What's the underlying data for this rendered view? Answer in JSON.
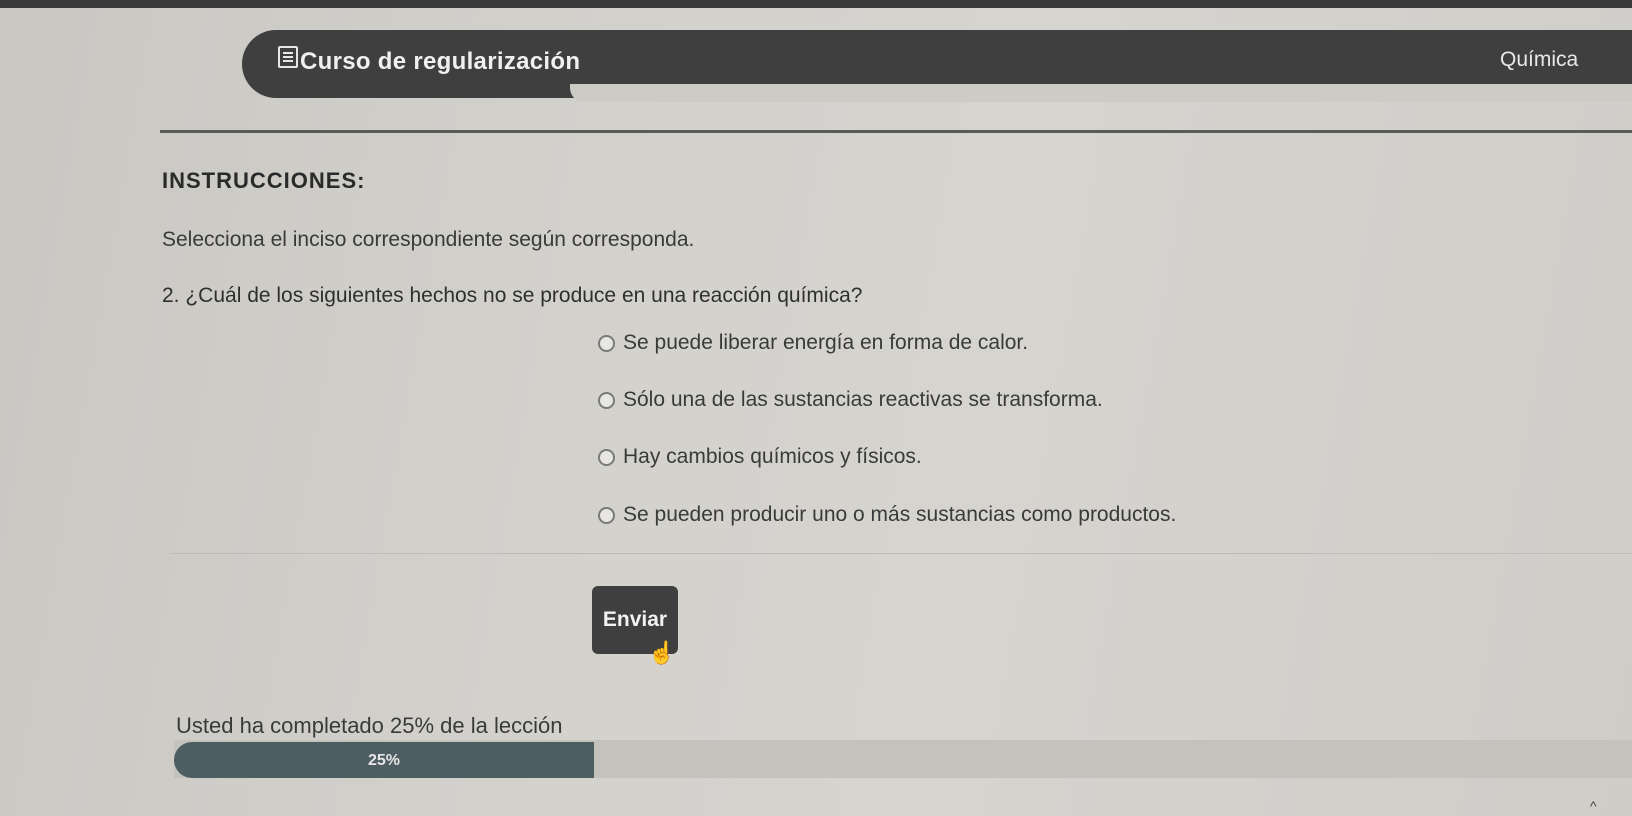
{
  "header": {
    "course_title": "Curso de regularización",
    "subject": "Química",
    "course_icon": "book-icon"
  },
  "instructions": {
    "heading": "INSTRUCCIONES:",
    "text": "Selecciona el inciso correspondiente según corresponda."
  },
  "question": {
    "text": "2. ¿Cuál de los siguientes hechos no se produce en una reacción química?",
    "options": [
      "Se puede liberar energía en forma de calor.",
      "Sólo una de las sustancias reactivas se transforma.",
      "Hay cambios químicos y físicos.",
      "Se pueden producir uno o más sustancias como productos."
    ]
  },
  "actions": {
    "send_label": "Enviar"
  },
  "progress": {
    "text": "Usted ha completado 25% de la lección",
    "label": "25%",
    "value": 0.25
  },
  "colors": {
    "header_bg": "#3f3f3f",
    "button_bg": "#3f3f3f",
    "progress_fill": "#4d5d61"
  }
}
